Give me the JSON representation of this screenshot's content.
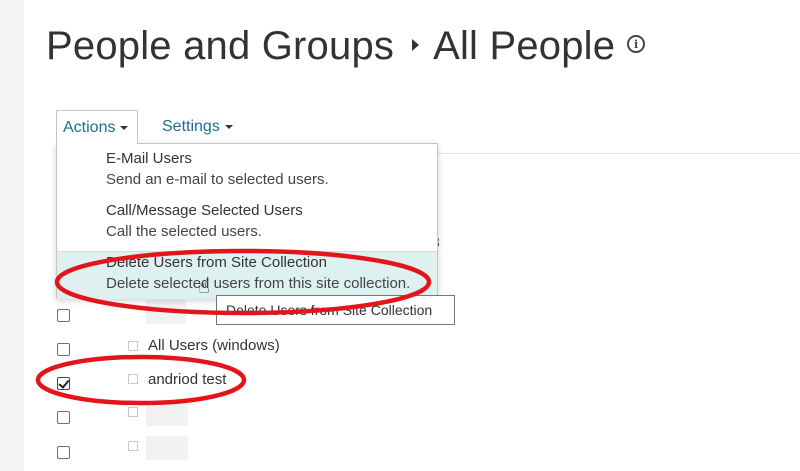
{
  "header": {
    "breadcrumb_parent": "People and Groups",
    "page_title": "All People"
  },
  "toolbar": {
    "actions_label": "Actions",
    "settings_label": "Settings"
  },
  "actions_menu": {
    "items": [
      {
        "title": "E-Mail Users",
        "description": "Send an e-mail to selected users."
      },
      {
        "title": "Call/Message Selected Users",
        "description": "Call the selected users."
      },
      {
        "title": "Delete Users from Site Collection",
        "description": "Delete selected users from this site collection."
      }
    ],
    "highlighted_index": 2
  },
  "tooltip": {
    "text": "Delete Users from Site Collection"
  },
  "list": {
    "partial_digit": "3",
    "rows": [
      {
        "name": "",
        "checked": false
      },
      {
        "name": "All Users (windows)",
        "checked": false
      },
      {
        "name": "andriod test",
        "checked": true
      },
      {
        "name": "",
        "checked": false
      },
      {
        "name": "",
        "checked": false
      }
    ]
  },
  "colors": {
    "link_accent": "#1d6e8f",
    "menu_highlight": "#dff0f1",
    "annotation_red": "#e4141b"
  },
  "icons": {
    "info": "info-icon",
    "cursor": "hand-pointer-icon",
    "breadcrumb_separator": "triangle-right-icon"
  }
}
